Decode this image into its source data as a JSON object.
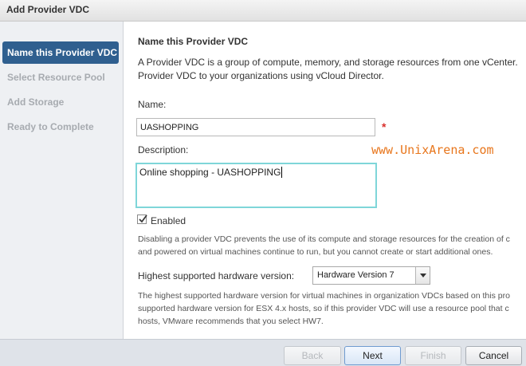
{
  "window": {
    "title": "Add Provider VDC"
  },
  "sidebar": {
    "steps": [
      {
        "label": "Name this Provider VDC",
        "active": true
      },
      {
        "label": "Select Resource Pool",
        "active": false
      },
      {
        "label": "Add Storage",
        "active": false
      },
      {
        "label": "Ready to Complete",
        "active": false
      }
    ]
  },
  "main": {
    "heading": "Name this Provider VDC",
    "intro_line1": "A Provider VDC is a group of compute, memory, and storage resources from one vCenter.",
    "intro_line2": "Provider VDC to your organizations using vCloud Director.",
    "name_label": "Name:",
    "name_value": "UASHOPPING",
    "required_marker": "*",
    "description_label": "Description:",
    "description_value": "Online shopping - UASHOPPING",
    "watermark": "www.UnixArena.com",
    "enabled_label": "Enabled",
    "enabled_checked": true,
    "disable_note_line1": "Disabling a provider VDC prevents the use of its compute and storage resources for the creation of c",
    "disable_note_line2": "and powered on virtual machines continue to run, but you cannot create or start additional ones.",
    "hw_label": "Highest supported hardware version:",
    "hw_value": "Hardware Version 7",
    "hw_note_line1": "The highest supported hardware version for virtual machines in organization VDCs based on this pro",
    "hw_note_line2": "supported hardware version for ESX 4.x hosts, so if this provider VDC will use a resource pool that c",
    "hw_note_line3": "hosts, VMware recommends that you select HW7."
  },
  "footer": {
    "back_label": "Back",
    "next_label": "Next",
    "finish_label": "Finish",
    "cancel_label": "Cancel"
  }
}
